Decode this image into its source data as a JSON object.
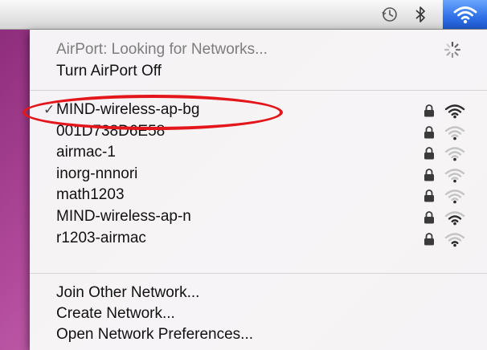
{
  "menubar": {
    "icons": [
      "time-machine-icon",
      "bluetooth-icon",
      "wifi-icon"
    ],
    "accent_color": "#2f6fe6"
  },
  "airport_menu": {
    "status_text": "AirPort: Looking for Networks...",
    "toggle_label": "Turn AirPort Off",
    "networks": [
      {
        "name": "MIND-wireless-ap-bg",
        "connected": true,
        "secured": true,
        "signal_bars": 4
      },
      {
        "name": "001D738D6E58",
        "connected": false,
        "secured": true,
        "signal_bars": 1
      },
      {
        "name": "airmac-1",
        "connected": false,
        "secured": true,
        "signal_bars": 1
      },
      {
        "name": "inorg-nnnori",
        "connected": false,
        "secured": true,
        "signal_bars": 1
      },
      {
        "name": "math1203",
        "connected": false,
        "secured": true,
        "signal_bars": 1
      },
      {
        "name": "MIND-wireless-ap-n",
        "connected": false,
        "secured": true,
        "signal_bars": 3
      },
      {
        "name": "r1203-airmac",
        "connected": false,
        "secured": true,
        "signal_bars": 2
      }
    ],
    "actions": {
      "join_other": "Join Other Network...",
      "create": "Create Network...",
      "preferences": "Open Network Preferences..."
    },
    "annotation_color": "#e3161c"
  }
}
